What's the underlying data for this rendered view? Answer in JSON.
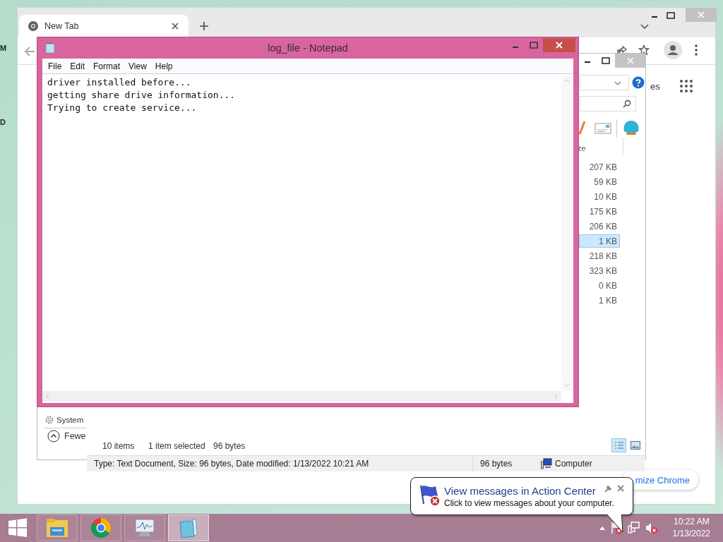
{
  "desktop": {
    "icon_labels": [
      "M",
      "D"
    ]
  },
  "browser": {
    "tabs": [
      {
        "title": "New Tab",
        "selected": true
      }
    ],
    "shortcut_link": "es",
    "customize_button": "mize Chrome"
  },
  "explorer": {
    "column_header": "ze",
    "rows": [
      {
        "size": "207 KB",
        "selected": false
      },
      {
        "size": "59 KB",
        "selected": false
      },
      {
        "size": "10 KB",
        "selected": false
      },
      {
        "size": "175 KB",
        "selected": false
      },
      {
        "size": "206 KB",
        "selected": false
      },
      {
        "size": "1 KB",
        "selected": true
      },
      {
        "size": "218 KB",
        "selected": false
      },
      {
        "size": "323 KB",
        "selected": false
      },
      {
        "size": "0 KB",
        "selected": false
      },
      {
        "size": "1 KB",
        "selected": false
      }
    ],
    "nav_items": [
      {
        "label": "System"
      }
    ],
    "fewer_details": "Fewe",
    "status": {
      "item_count": "10 items",
      "selection": "1 item selected",
      "selection_size": "96 bytes"
    },
    "views": [
      {
        "kind": "details",
        "selected": true
      },
      {
        "kind": "preview",
        "selected": false
      }
    ],
    "details_bar": {
      "summary": "Type: Text Document, Size: 96 bytes, Date modified: 1/13/2022 10:21 AM",
      "size": "96 bytes",
      "location": "Computer"
    }
  },
  "notepad": {
    "title": "log_file - Notepad",
    "menu": [
      "File",
      "Edit",
      "Format",
      "View",
      "Help"
    ],
    "lines": [
      "driver installed before...",
      "getting share drive information...",
      "Trying to create service..."
    ]
  },
  "taskbar": {
    "apps": [
      {
        "kind": "explorer",
        "selected": false
      },
      {
        "kind": "chrome",
        "selected": false
      },
      {
        "kind": "monitor",
        "selected": false
      },
      {
        "kind": "notepad",
        "selected": true
      }
    ],
    "clock": {
      "time": "10:22 AM",
      "date": "1/13/2022"
    }
  },
  "notification": {
    "title": "View messages in Action Center",
    "body": "Click to view messages about your computer."
  }
}
